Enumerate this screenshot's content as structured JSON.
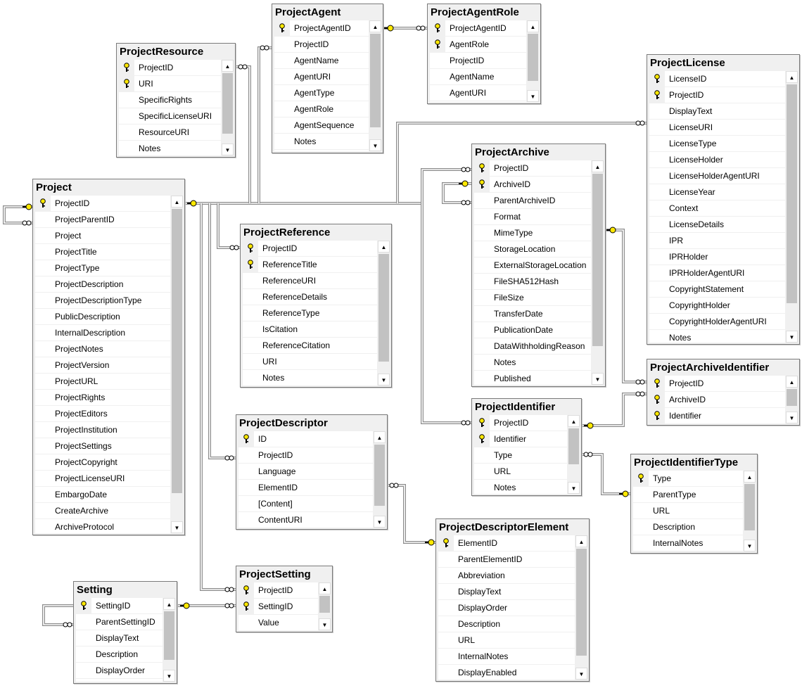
{
  "diagram": {
    "colors": {
      "key": "#ffe800",
      "line": "#8c8c8c",
      "border": "#7a7a7a"
    },
    "icons": {
      "primary_key": "key-icon",
      "many_end": "infinity-icon",
      "one_end": "key-icon",
      "scroll_up": "▲",
      "scroll_down": "▼"
    },
    "tables": [
      {
        "name": "ProjectAgent",
        "columns": [
          {
            "name": "ProjectAgentID",
            "pk": true
          },
          {
            "name": "ProjectID"
          },
          {
            "name": "AgentName"
          },
          {
            "name": "AgentURI"
          },
          {
            "name": "AgentType"
          },
          {
            "name": "AgentRole"
          },
          {
            "name": "AgentSequence"
          },
          {
            "name": "Notes"
          }
        ]
      },
      {
        "name": "ProjectAgentRole",
        "columns": [
          {
            "name": "ProjectAgentID",
            "pk": true
          },
          {
            "name": "AgentRole",
            "pk": true
          },
          {
            "name": "ProjectID"
          },
          {
            "name": "AgentName"
          },
          {
            "name": "AgentURI"
          }
        ]
      },
      {
        "name": "ProjectResource",
        "columns": [
          {
            "name": "ProjectID",
            "pk": true
          },
          {
            "name": "URI",
            "pk": true
          },
          {
            "name": "SpecificRights"
          },
          {
            "name": "SpecificLicenseURI"
          },
          {
            "name": "ResourceURI"
          },
          {
            "name": "Notes"
          }
        ]
      },
      {
        "name": "ProjectLicense",
        "columns": [
          {
            "name": "LicenseID",
            "pk": true
          },
          {
            "name": "ProjectID",
            "pk": true
          },
          {
            "name": "DisplayText"
          },
          {
            "name": "LicenseURI"
          },
          {
            "name": "LicenseType"
          },
          {
            "name": "LicenseHolder"
          },
          {
            "name": "LicenseHolderAgentURI"
          },
          {
            "name": "LicenseYear"
          },
          {
            "name": "Context"
          },
          {
            "name": "LicenseDetails"
          },
          {
            "name": "IPR"
          },
          {
            "name": "IPRHolder"
          },
          {
            "name": "IPRHolderAgentURI"
          },
          {
            "name": "CopyrightStatement"
          },
          {
            "name": "CopyrightHolder"
          },
          {
            "name": "CopyrightHolderAgentURI"
          },
          {
            "name": "Notes"
          }
        ]
      },
      {
        "name": "ProjectArchive",
        "columns": [
          {
            "name": "ProjectID",
            "pk": true
          },
          {
            "name": "ArchiveID",
            "pk": true
          },
          {
            "name": "ParentArchiveID"
          },
          {
            "name": "Format"
          },
          {
            "name": "MimeType"
          },
          {
            "name": "StorageLocation"
          },
          {
            "name": "ExternalStorageLocation"
          },
          {
            "name": "FileSHA512Hash"
          },
          {
            "name": "FileSize"
          },
          {
            "name": "TransferDate"
          },
          {
            "name": "PublicationDate"
          },
          {
            "name": "DataWithholdingReason"
          },
          {
            "name": "Notes"
          },
          {
            "name": "Published"
          }
        ]
      },
      {
        "name": "Project",
        "columns": [
          {
            "name": "ProjectID",
            "pk": true
          },
          {
            "name": "ProjectParentID"
          },
          {
            "name": "Project"
          },
          {
            "name": "ProjectTitle"
          },
          {
            "name": "ProjectType"
          },
          {
            "name": "ProjectDescription"
          },
          {
            "name": "ProjectDescriptionType"
          },
          {
            "name": "PublicDescription"
          },
          {
            "name": "InternalDescription"
          },
          {
            "name": "ProjectNotes"
          },
          {
            "name": "ProjectVersion"
          },
          {
            "name": "ProjectURL"
          },
          {
            "name": "ProjectRights"
          },
          {
            "name": "ProjectEditors"
          },
          {
            "name": "ProjectInstitution"
          },
          {
            "name": "ProjectSettings"
          },
          {
            "name": "ProjectCopyright"
          },
          {
            "name": "ProjectLicenseURI"
          },
          {
            "name": "EmbargoDate"
          },
          {
            "name": "CreateArchive"
          },
          {
            "name": "ArchiveProtocol"
          }
        ]
      },
      {
        "name": "ProjectReference",
        "columns": [
          {
            "name": "ProjectID",
            "pk": true
          },
          {
            "name": "ReferenceTitle",
            "pk": true
          },
          {
            "name": "ReferenceURI"
          },
          {
            "name": "ReferenceDetails"
          },
          {
            "name": "ReferenceType"
          },
          {
            "name": "IsCitation"
          },
          {
            "name": "ReferenceCitation"
          },
          {
            "name": "URI"
          },
          {
            "name": "Notes"
          }
        ]
      },
      {
        "name": "ProjectArchiveIdentifier",
        "columns": [
          {
            "name": "ProjectID",
            "pk": true
          },
          {
            "name": "ArchiveID",
            "pk": true
          },
          {
            "name": "Identifier",
            "pk": true
          }
        ]
      },
      {
        "name": "ProjectIdentifier",
        "columns": [
          {
            "name": "ProjectID",
            "pk": true
          },
          {
            "name": "Identifier",
            "pk": true
          },
          {
            "name": "Type"
          },
          {
            "name": "URL"
          },
          {
            "name": "Notes"
          }
        ]
      },
      {
        "name": "ProjectDescriptor",
        "columns": [
          {
            "name": "ID",
            "pk": true
          },
          {
            "name": "ProjectID"
          },
          {
            "name": "Language"
          },
          {
            "name": "ElementID"
          },
          {
            "name": "[Content]"
          },
          {
            "name": "ContentURI"
          }
        ]
      },
      {
        "name": "ProjectIdentifierType",
        "columns": [
          {
            "name": "Type",
            "pk": true
          },
          {
            "name": "ParentType"
          },
          {
            "name": "URL"
          },
          {
            "name": "Description"
          },
          {
            "name": "InternalNotes"
          }
        ]
      },
      {
        "name": "ProjectDescriptorElement",
        "columns": [
          {
            "name": "ElementID",
            "pk": true
          },
          {
            "name": "ParentElementID"
          },
          {
            "name": "Abbreviation"
          },
          {
            "name": "DisplayText"
          },
          {
            "name": "DisplayOrder"
          },
          {
            "name": "Description"
          },
          {
            "name": "URL"
          },
          {
            "name": "InternalNotes"
          },
          {
            "name": "DisplayEnabled"
          }
        ]
      },
      {
        "name": "Setting",
        "columns": [
          {
            "name": "SettingID",
            "pk": true
          },
          {
            "name": "ParentSettingID"
          },
          {
            "name": "DisplayText"
          },
          {
            "name": "Description"
          },
          {
            "name": "DisplayOrder"
          }
        ]
      },
      {
        "name": "ProjectSetting",
        "columns": [
          {
            "name": "ProjectID",
            "pk": true
          },
          {
            "name": "SettingID",
            "pk": true
          },
          {
            "name": "Value"
          }
        ]
      }
    ],
    "relationships": [
      {
        "from": "Project",
        "to": "Project"
      },
      {
        "from": "ProjectAgent",
        "to": "ProjectAgentRole"
      },
      {
        "from": "Project",
        "to": "ProjectResource"
      },
      {
        "from": "Project",
        "to": "ProjectAgent"
      },
      {
        "from": "Project",
        "to": "ProjectLicense"
      },
      {
        "from": "Project",
        "to": "ProjectArchive"
      },
      {
        "from": "Project",
        "to": "ProjectIdentifier"
      },
      {
        "from": "Project",
        "to": "ProjectReference"
      },
      {
        "from": "Project",
        "to": "ProjectDescriptor"
      },
      {
        "from": "Project",
        "to": "ProjectSetting"
      },
      {
        "from": "ProjectArchive",
        "to": "ProjectArchive"
      },
      {
        "from": "ProjectArchive",
        "to": "ProjectArchiveIdentifier"
      },
      {
        "from": "ProjectIdentifier",
        "to": "ProjectArchiveIdentifier"
      },
      {
        "from": "ProjectIdentifierType",
        "to": "ProjectIdentifier"
      },
      {
        "from": "ProjectDescriptorElement",
        "to": "ProjectDescriptor"
      },
      {
        "from": "Setting",
        "to": "Setting"
      },
      {
        "from": "Setting",
        "to": "ProjectSetting"
      }
    ]
  }
}
